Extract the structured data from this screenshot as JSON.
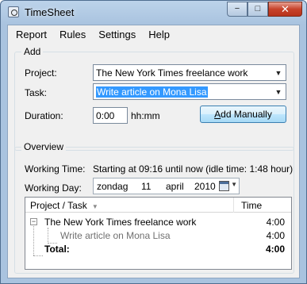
{
  "window": {
    "title": "TimeSheet",
    "minimize_glyph": "−",
    "maximize_glyph": "□",
    "close_glyph": "✕"
  },
  "menu": {
    "items": [
      "Report",
      "Rules",
      "Settings",
      "Help"
    ]
  },
  "add_group": {
    "label": "Add",
    "project_label": "Project:",
    "project_value": "The New York Times freelance work",
    "task_label": "Task:",
    "task_value": "Write article on Mona Lisa",
    "duration_label": "Duration:",
    "duration_value": "0:00",
    "duration_unit": "hh:mm",
    "add_button_prefix": "",
    "add_button_mnemonic": "A",
    "add_button_rest": "dd Manually"
  },
  "overview_group": {
    "label": "Overview",
    "working_time_label": "Working Time:",
    "working_time_value": "Starting at 09:16 until now (idle time: 1:48 hour)",
    "working_day_label": "Working Day:",
    "date": {
      "weekday": "zondag",
      "day": "11",
      "month": "april",
      "year": "2010"
    }
  },
  "tree": {
    "columns": [
      "Project / Task",
      "Time"
    ],
    "rows": [
      {
        "label": "The New York Times freelance work",
        "time": "4:00",
        "kind": "project",
        "expanded": true
      },
      {
        "label": "Write article on Mona Lisa",
        "time": "4:00",
        "kind": "task"
      },
      {
        "label": "Total:",
        "time": "4:00",
        "kind": "total"
      }
    ],
    "toggle_glyph": "−"
  },
  "icons": {
    "app": "timesheet-app-icon",
    "dropdown": "chevron-down-icon",
    "calendar": "calendar-icon"
  },
  "colors": {
    "selection": "#3399ff",
    "task_text": "#707070",
    "button_border": "#3c7fb1"
  }
}
